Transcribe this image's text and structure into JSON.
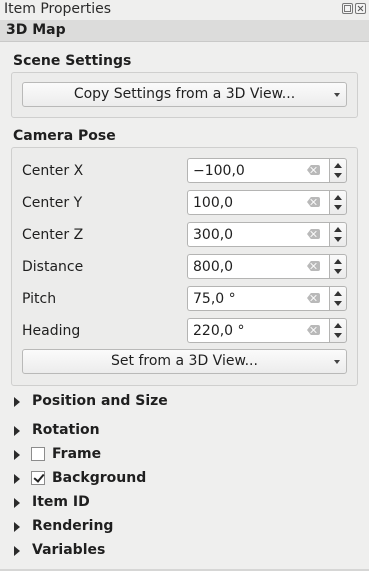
{
  "window": {
    "title": "Item Properties"
  },
  "header": {
    "title": "3D Map"
  },
  "scene_settings": {
    "title": "Scene Settings",
    "copy_button": "Copy Settings from a 3D View..."
  },
  "camera_pose": {
    "title": "Camera Pose",
    "fields": [
      {
        "label": "Center X",
        "value": "−100,0"
      },
      {
        "label": "Center Y",
        "value": "100,0"
      },
      {
        "label": "Center Z",
        "value": "300,0"
      },
      {
        "label": "Distance",
        "value": "800,0"
      },
      {
        "label": "Pitch",
        "value": "75,0 °"
      },
      {
        "label": "Heading",
        "value": "220,0 °"
      }
    ],
    "set_button": "Set from a 3D View..."
  },
  "sections": [
    {
      "label": "Position and Size",
      "checkbox": null
    },
    {
      "label": "Rotation",
      "checkbox": null
    },
    {
      "label": "Frame",
      "checkbox": false
    },
    {
      "label": "Background",
      "checkbox": true
    },
    {
      "label": "Item ID",
      "checkbox": null
    },
    {
      "label": "Rendering",
      "checkbox": null
    },
    {
      "label": "Variables",
      "checkbox": null
    }
  ],
  "icons": {
    "float": "float-icon",
    "close": "close-icon",
    "clear": "clear-field-icon",
    "expand": "expand-arrow-icon",
    "dropdown": "dropdown-arrow-icon"
  }
}
